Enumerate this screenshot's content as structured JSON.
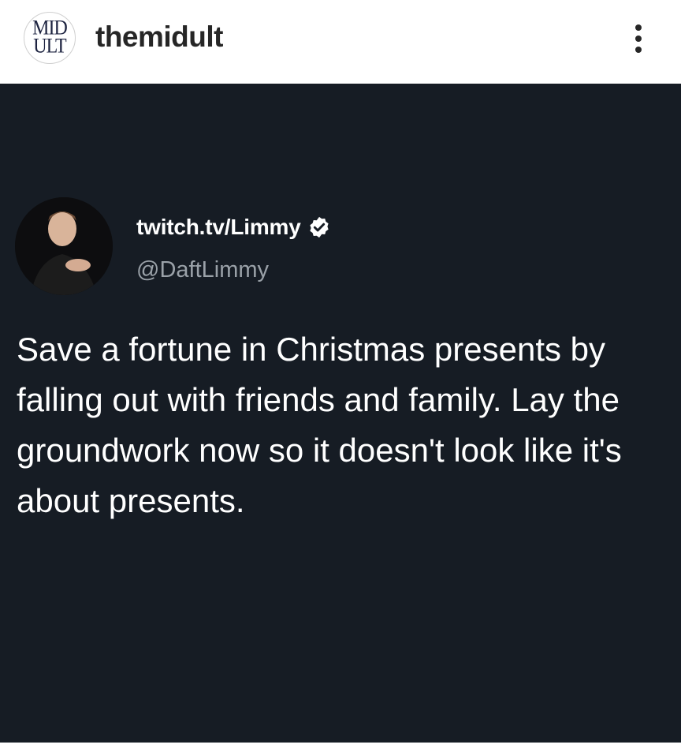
{
  "header": {
    "account_logo_text": [
      "MID",
      "ULT"
    ],
    "username": "themidult",
    "more_icon": "more-vertical-icon"
  },
  "tweet": {
    "display_name": "twitch.tv/Limmy",
    "verified_icon": "verified-badge-icon",
    "handle": "@DaftLimmy",
    "text": "Save a fortune in Christmas presents by falling out with friends and family. Lay the groundwork now so it doesn't look like it's about presents."
  },
  "colors": {
    "post_background": "#161c24",
    "text": "#ffffff",
    "handle": "#9aa1a8"
  }
}
